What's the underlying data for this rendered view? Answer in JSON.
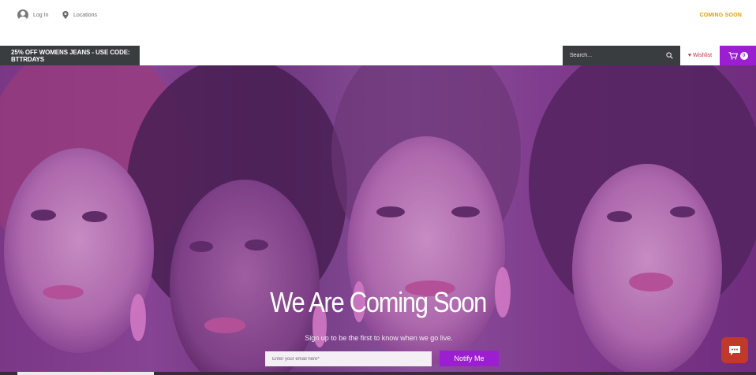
{
  "topbar": {
    "login_label": "Log In",
    "locations_label": "Locations",
    "coming_soon_label": "COMING SOON"
  },
  "nav": {
    "promo_text": "25% OFF WOMENS JEANS - USE CODE: BTTRDAYS",
    "search_placeholder": "Search...",
    "wishlist_label": "Wishlist",
    "cart_count": "0"
  },
  "hero": {
    "title": "We Are Coming Soon",
    "subtitle": "Sign up to be the first to know when we go live.",
    "email_placeholder": "Enter your email here*",
    "notify_label": "Notify Me"
  },
  "colors": {
    "accent": "#9b1fd1",
    "dark_bar": "#3a3d3f",
    "coming_soon": "#e0a100",
    "chat": "#c0392b"
  },
  "icons": [
    "user-icon",
    "location-pin-icon",
    "search-icon",
    "heart-icon",
    "cart-icon",
    "chat-icon"
  ]
}
